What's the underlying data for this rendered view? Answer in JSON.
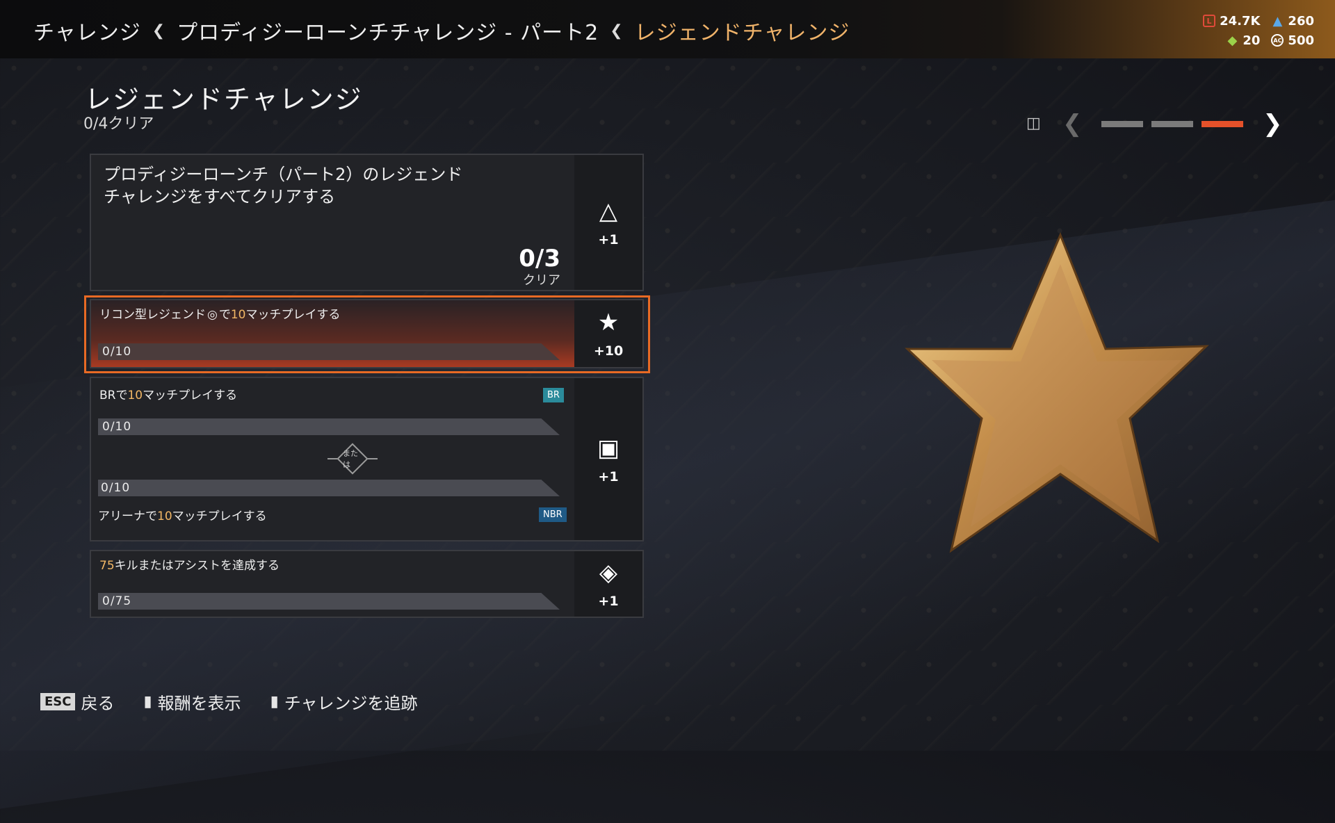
{
  "breadcrumb": {
    "items": [
      "チャレンジ",
      "プロディジーローンチチャレンジ - パート2",
      "レジェンドチャレンジ"
    ]
  },
  "currency": {
    "legend_tokens": "24.7K",
    "crafting_metals": "260",
    "tokens": "20",
    "apex_coins": "500"
  },
  "page": {
    "title": "レジェンドチャレンジ",
    "subtitle": "0/4クリア"
  },
  "pager": {
    "total": 3,
    "active_index": 2
  },
  "cards": {
    "main": {
      "text": "プロディジーローンチ（パート2）のレジェンドチャレンジをすべてクリアする",
      "count": "0/3",
      "count_label": "クリア",
      "reward": "+1",
      "reward_icon": "apex-pack-icon"
    },
    "recon": {
      "text_pre": "リコン型レジェンド",
      "text_mid": "で",
      "highlight": "10",
      "text_post": "マッチプレイする",
      "progress": "0/10",
      "reward": "+10",
      "reward_icon": "star-icon"
    },
    "br_arena": {
      "br_pre": "BRで",
      "br_highlight": "10",
      "br_post": "マッチプレイする",
      "br_tag": "BR",
      "br_progress": "0/10",
      "or_label": "または",
      "arena_progress": "0/10",
      "arena_pre": "アリーナで",
      "arena_highlight": "10",
      "arena_post": "マッチプレイする",
      "arena_tag": "NBR",
      "reward": "+1",
      "reward_icon": "card-pack-icon"
    },
    "kills": {
      "highlight": "75",
      "text_post": "キルまたはアシストを達成する",
      "progress": "0/75",
      "reward": "+1",
      "reward_icon": "badge-icon"
    }
  },
  "prompts": {
    "back_key": "ESC",
    "back": "戻る",
    "rewards": "報酬を表示",
    "track": "チャレンジを追跡"
  },
  "colors": {
    "accent_orange": "#e86a24",
    "highlight_gold": "#f2b765",
    "tag_br": "#2b8b9b",
    "tag_nbr": "#1f5a86"
  }
}
